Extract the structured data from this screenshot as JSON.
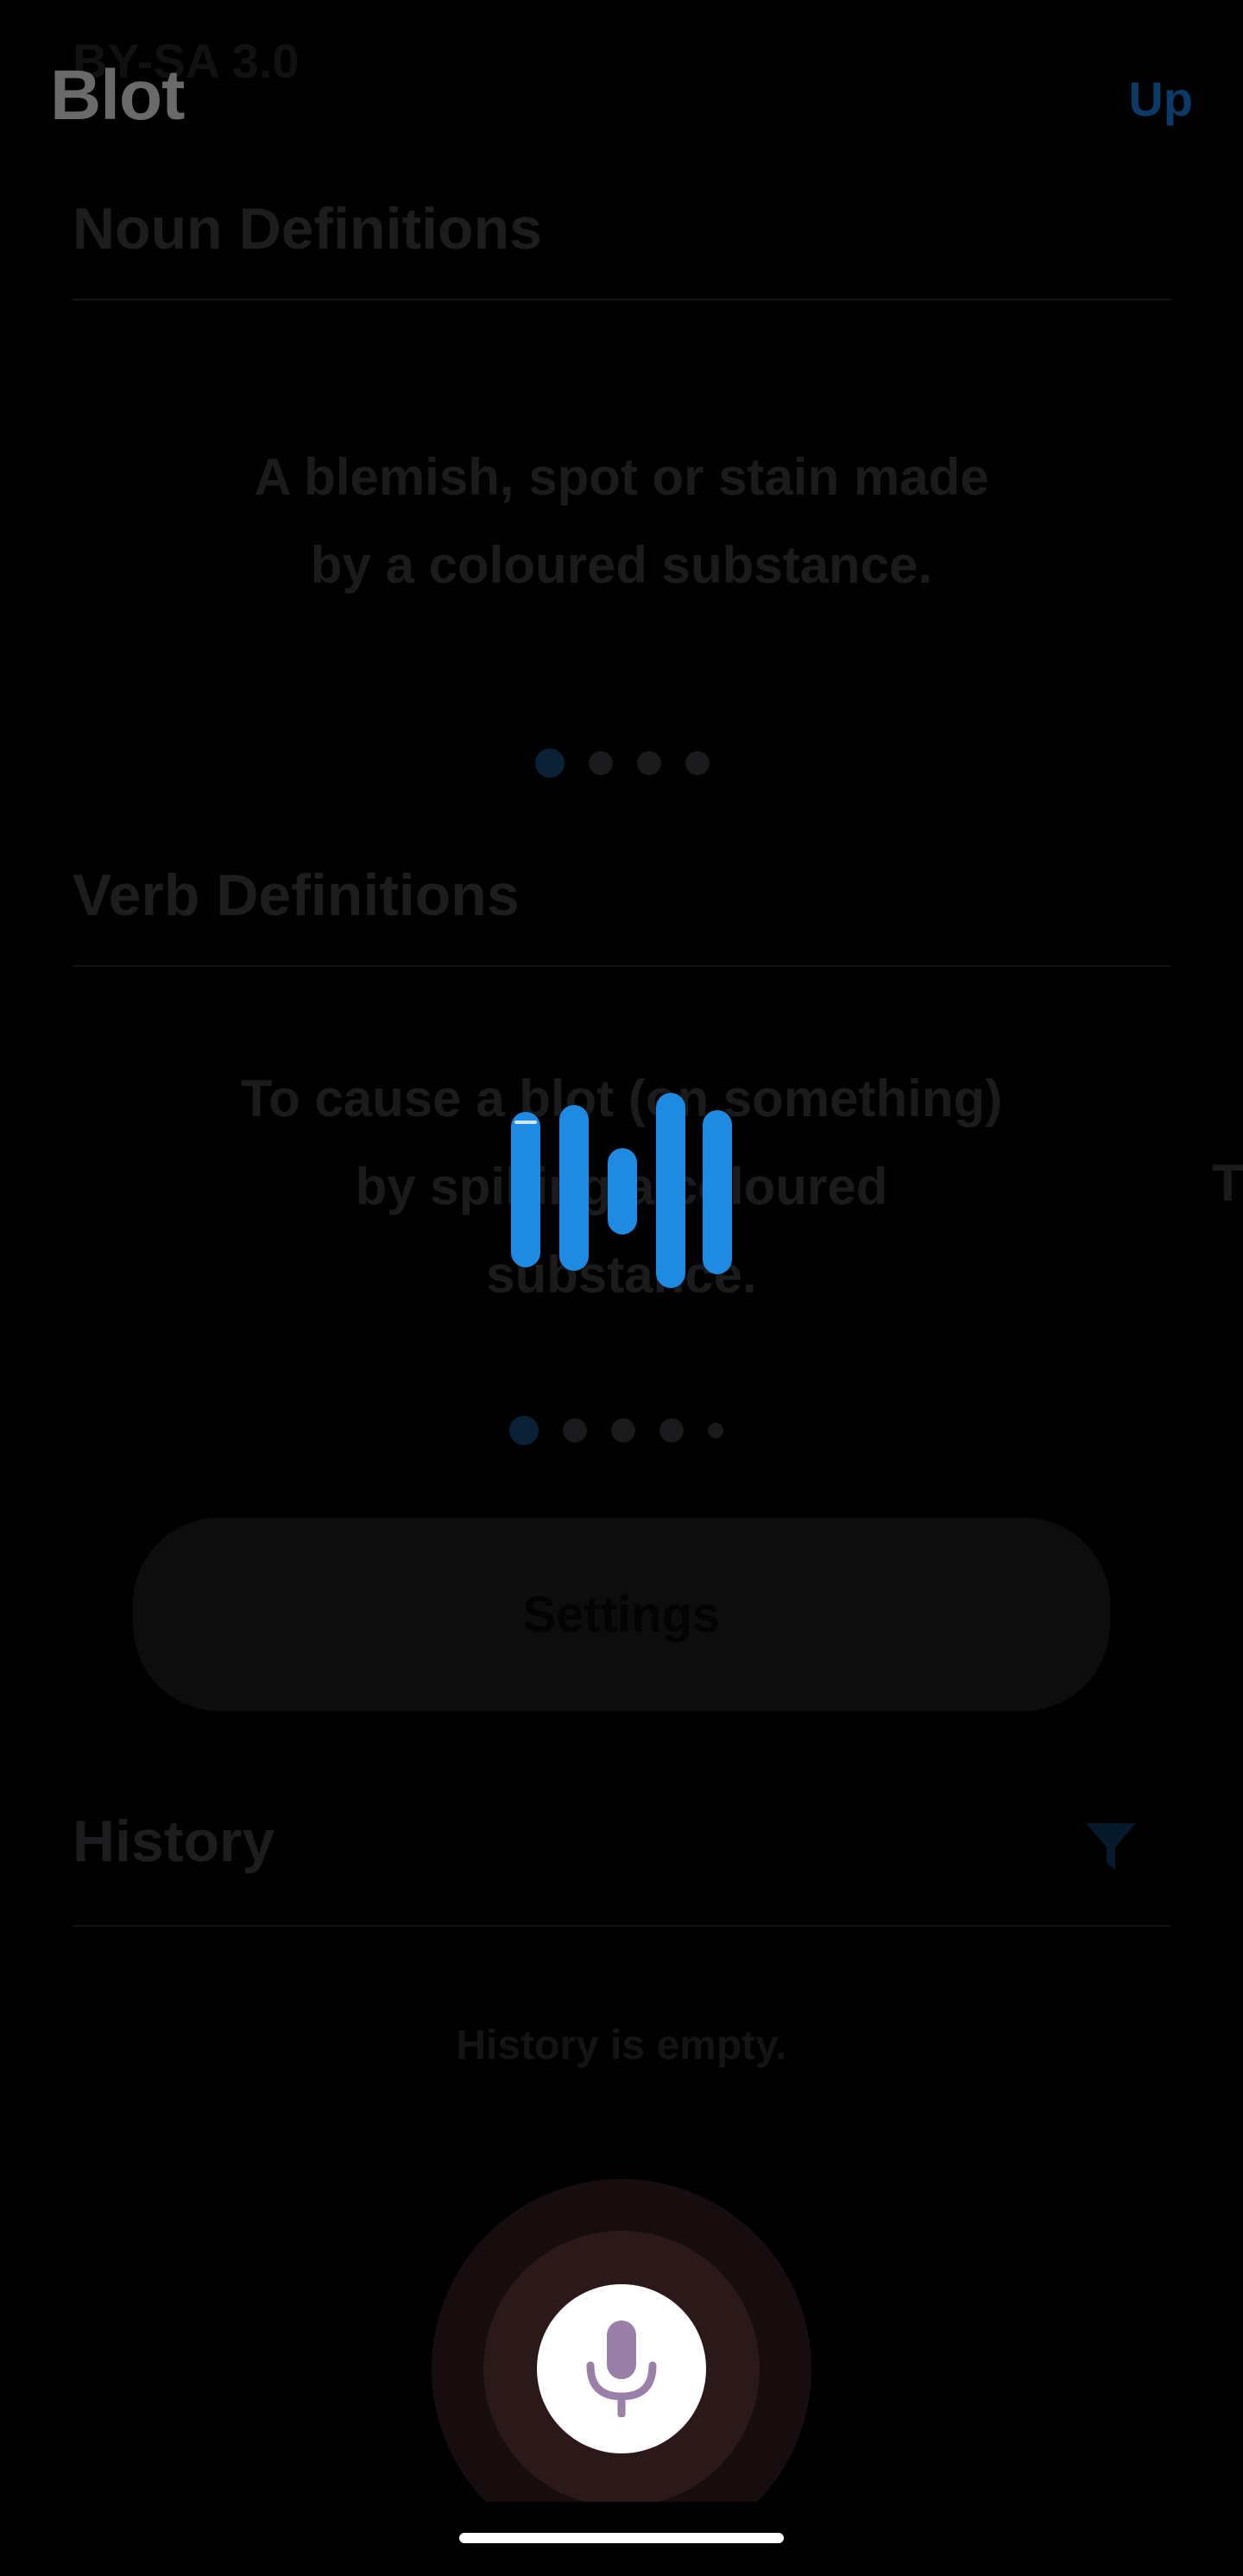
{
  "header": {
    "license": "BY-SA 3.0",
    "title": "Blot",
    "up_label": "Up"
  },
  "noun": {
    "heading": "Noun Definitions",
    "definition_line1": "A blemish, spot or stain made",
    "definition_line2": "by a coloured substance.",
    "pager_count": 4,
    "pager_active": 1
  },
  "verb": {
    "heading": "Verb Definitions",
    "definition_line1": "To cause a blot (on something)",
    "definition_line2": "by spilling a coloured",
    "definition_line3": "substance.",
    "next_card_peek": "T",
    "pager_count": 5,
    "pager_active": 1
  },
  "settings": {
    "label": "Settings"
  },
  "history": {
    "heading": "History",
    "empty_text": "History is empty."
  },
  "colors": {
    "accent": "#1f8ae2",
    "mic_icon": "#9a7fa8",
    "mic_ring_outer": "#170d0e",
    "mic_ring_inner": "#2b1819"
  },
  "icons": {
    "filter": "filter-icon",
    "mic": "microphone-icon",
    "loader": "audio-wave-loader-icon"
  }
}
